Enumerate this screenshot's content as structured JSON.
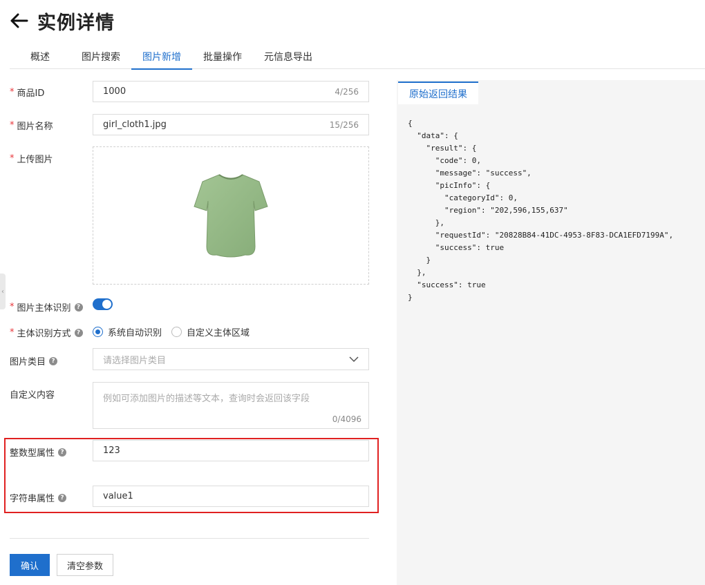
{
  "header": {
    "title": "实例详情",
    "back_icon": "arrow-left-icon"
  },
  "tabs": [
    {
      "label": "概述",
      "active": false
    },
    {
      "label": "图片搜索",
      "active": false
    },
    {
      "label": "图片新增",
      "active": true
    },
    {
      "label": "批量操作",
      "active": false
    },
    {
      "label": "元信息导出",
      "active": false
    }
  ],
  "form": {
    "product_id": {
      "label": "商品ID",
      "value": "1000",
      "count": "4/256"
    },
    "image_name": {
      "label": "图片名称",
      "value": "girl_cloth1.jpg",
      "count": "15/256"
    },
    "upload": {
      "label": "上传图片",
      "image": "green-tshirt"
    },
    "subject_detect": {
      "label": "图片主体识别",
      "enabled": true
    },
    "detect_mode": {
      "label": "主体识别方式",
      "options": [
        "系统自动识别",
        "自定义主体区域"
      ],
      "selected": "系统自动识别"
    },
    "category": {
      "label": "图片类目",
      "placeholder": "请选择图片类目"
    },
    "custom_content": {
      "label": "自定义内容",
      "placeholder": "例如可添加图片的描述等文本，查询时会返回该字段",
      "count": "0/4096"
    },
    "int_attr": {
      "label": "整数型属性",
      "value": "123"
    },
    "str_attr": {
      "label": "字符串属性",
      "value": "value1"
    }
  },
  "buttons": {
    "confirm": "确认",
    "clear": "清空参数"
  },
  "result_panel": {
    "tab": "原始返回结果",
    "json_text": "{\n  \"data\": {\n    \"result\": {\n      \"code\": 0,\n      \"message\": \"success\",\n      \"picInfo\": {\n        \"categoryId\": 0,\n        \"region\": \"202,596,155,637\"\n      },\n      \"requestId\": \"20828B84-41DC-4953-8F83-DCA1EFD7199A\",\n      \"success\": true\n    }\n  },\n  \"success\": true\n}"
  },
  "colors": {
    "accent": "#1f6fcc",
    "required": "#e8363b",
    "highlight_box": "#e02020"
  }
}
